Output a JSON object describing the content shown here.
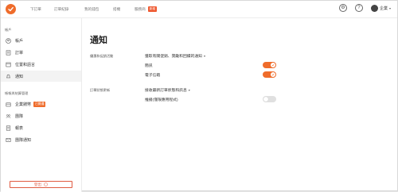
{
  "nav": {
    "items": [
      "下訂單",
      "訂單紀錄",
      "我的錢包",
      "搭機",
      "服務商"
    ],
    "badge": "新增"
  },
  "user": {
    "name": "企業"
  },
  "sidebar": {
    "section_account": "帳戶",
    "section_business": "帳報與結算管理",
    "items": [
      {
        "label": "帳戶",
        "icon": "user-icon"
      },
      {
        "label": "訂單",
        "icon": "receipt-icon"
      },
      {
        "label": "位置和語言",
        "icon": "globe-icon"
      },
      {
        "label": "通知",
        "icon": "bell-icon"
      }
    ],
    "business_items": [
      {
        "label": "企業錢幣",
        "icon": "building-icon",
        "tag": "已開通"
      },
      {
        "label": "團隊",
        "icon": "team-icon"
      },
      {
        "label": "報表",
        "icon": "report-icon"
      },
      {
        "label": "團隊通知",
        "icon": "mail-icon"
      }
    ],
    "logout": "登出"
  },
  "main": {
    "title": "通知",
    "section1_label": "優惠和促銷活動",
    "section1_heading": "獲取有關促銷、獎勵和回饋的通知",
    "section1_options": [
      {
        "label": "簡訊",
        "enabled": true
      },
      {
        "label": "電子信箱",
        "enabled": true
      }
    ],
    "section2_label": "訂單狀態更新",
    "section2_heading": "接收最新訂單狀態和訊息",
    "section2_options": [
      {
        "label": "推播(僅限應用程式)",
        "enabled": false
      }
    ]
  },
  "colors": {
    "accent": "#ef6c2b",
    "danger": "#e05a40"
  }
}
